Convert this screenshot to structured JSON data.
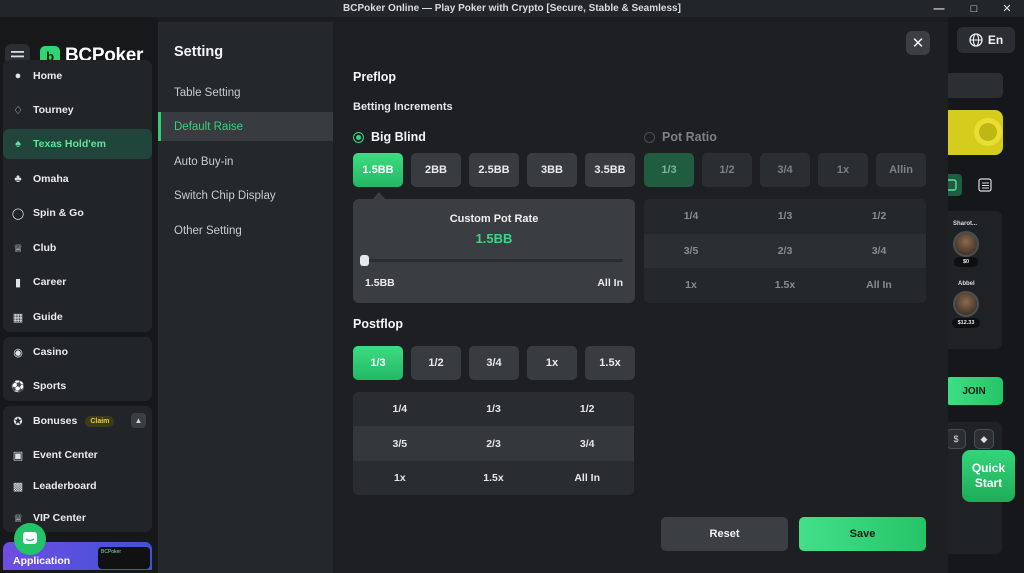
{
  "window": {
    "title": "BCPoker Online — Play Poker with Crypto [Secure, Stable & Seamless]",
    "minimize_icon": "minimize-icon",
    "maximize_icon": "maximize-icon",
    "close_icon": "close-icon"
  },
  "brand": {
    "name": "BCPoker"
  },
  "sidebar": {
    "items": [
      {
        "label": "Home",
        "icon": "home-icon"
      },
      {
        "label": "Tourney",
        "icon": "trophy-icon"
      },
      {
        "label": "Texas Hold'em",
        "icon": "cards-icon",
        "active": true
      },
      {
        "label": "Omaha",
        "icon": "omaha-icon"
      },
      {
        "label": "Spin & Go",
        "icon": "spin-icon"
      },
      {
        "label": "Club",
        "icon": "crown-icon"
      },
      {
        "label": "Career",
        "icon": "chart-icon"
      },
      {
        "label": "Guide",
        "icon": "book-icon"
      },
      {
        "label": "Casino",
        "icon": "casino-icon"
      },
      {
        "label": "Sports",
        "icon": "ball-icon"
      },
      {
        "label": "Bonuses",
        "icon": "star-icon",
        "badge": "Claim"
      },
      {
        "label": "Event Center",
        "icon": "gift-icon"
      },
      {
        "label": "Leaderboard",
        "icon": "podium-icon"
      },
      {
        "label": "VIP Center",
        "icon": "vip-crown-icon"
      }
    ],
    "app_banner": "Application",
    "app_phone_text": "BCPoker"
  },
  "settings": {
    "title": "Setting",
    "menu": [
      {
        "label": "Table Setting"
      },
      {
        "label": "Default Raise",
        "active": true
      },
      {
        "label": "Auto Buy-in"
      },
      {
        "label": "Switch Chip Display"
      },
      {
        "label": "Other Setting"
      }
    ]
  },
  "preflop": {
    "heading": "Preflop",
    "subheading": "Betting Increments",
    "big_blind_label": "Big Blind",
    "pot_ratio_label": "Pot Ratio",
    "big_blind_options": [
      "1.5BB",
      "2BB",
      "2.5BB",
      "3BB",
      "3.5BB"
    ],
    "pot_ratio_options": [
      "1/3",
      "1/2",
      "3/4",
      "1x",
      "Allin"
    ],
    "selected_big_blind": "1.5BB",
    "custom": {
      "title": "Custom Pot Rate",
      "value": "1.5BB",
      "min_label": "1.5BB",
      "max_label": "All In",
      "slider_level": 0
    },
    "pot_ratio_grid": [
      [
        "1/4",
        "1/3",
        "1/2"
      ],
      [
        "3/5",
        "2/3",
        "3/4"
      ],
      [
        "1x",
        "1.5x",
        "All In"
      ]
    ]
  },
  "postflop": {
    "heading": "Postflop",
    "options": [
      "1/3",
      "1/2",
      "3/4",
      "1x",
      "1.5x"
    ],
    "selected": "1/3",
    "grid": [
      [
        "1/4",
        "1/3",
        "1/2"
      ],
      [
        "3/5",
        "2/3",
        "3/4"
      ],
      [
        "1x",
        "1.5x",
        "All In"
      ]
    ]
  },
  "actions": {
    "reset": "Reset",
    "save": "Save"
  },
  "right_panel": {
    "language": "En",
    "players": [
      {
        "name": "Sharot...",
        "amount": "$0"
      },
      {
        "name": "Abbel",
        "amount": "$12.33"
      }
    ],
    "join": "JOIN",
    "quick_start": "Quick Start"
  },
  "colors": {
    "accent": "#2ecc71",
    "active_text": "#35d07f",
    "panel": "#25282b",
    "background": "#1d1f22"
  }
}
